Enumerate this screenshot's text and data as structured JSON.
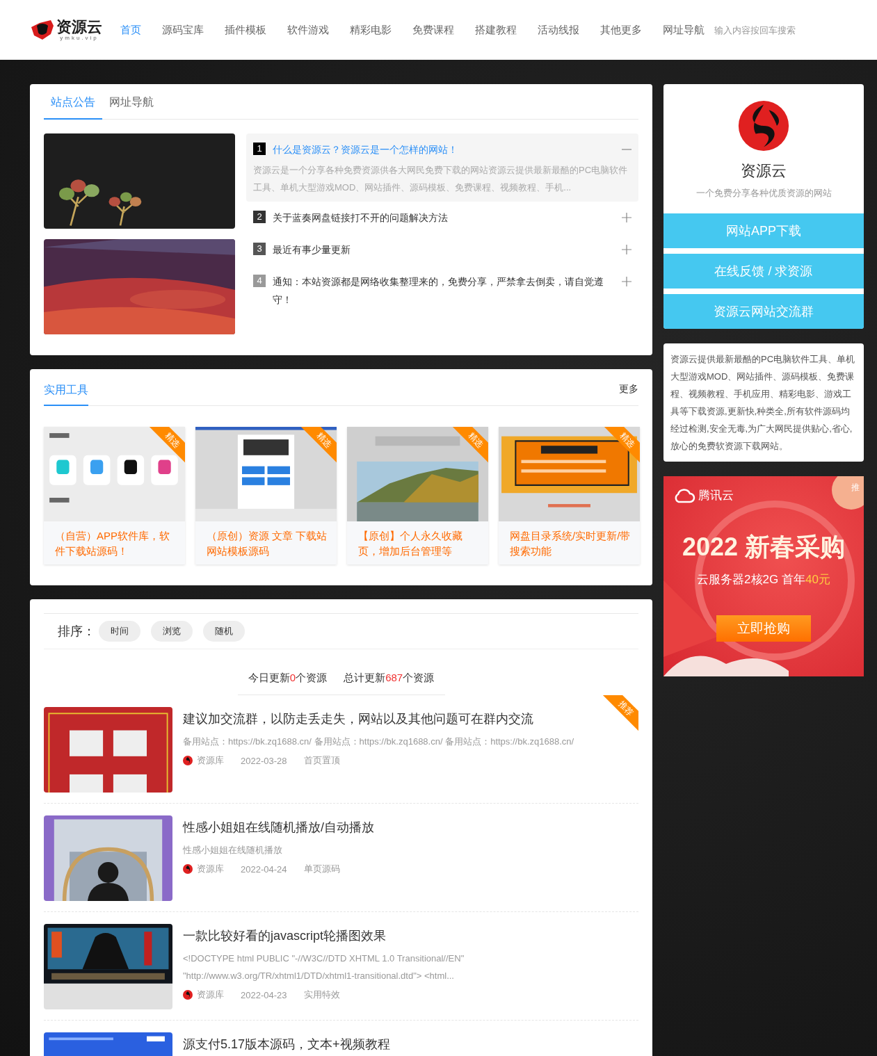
{
  "header": {
    "logo": {
      "name": "资源云",
      "domain": "ymku.vip"
    },
    "nav": [
      {
        "label": "首页",
        "selected": true
      },
      {
        "label": "源码宝库",
        "selected": false
      },
      {
        "label": "插件模板",
        "selected": false
      },
      {
        "label": "软件游戏",
        "selected": false
      },
      {
        "label": "精彩电影",
        "selected": false
      },
      {
        "label": "免费课程",
        "selected": false
      },
      {
        "label": "搭建教程",
        "selected": false
      },
      {
        "label": "活动线报",
        "selected": false
      },
      {
        "label": "其他更多",
        "selected": false
      },
      {
        "label": "网址导航",
        "selected": false
      }
    ],
    "search": {
      "placeholder": "输入内容按回车搜索"
    }
  },
  "notice_panel": {
    "tabs": [
      {
        "label": "站点公告",
        "selected": true
      },
      {
        "label": "网址导航",
        "selected": false
      }
    ],
    "notices": [
      {
        "number": "1",
        "title": "什么是资源云？资源云是一个怎样的网站！",
        "expanded": true,
        "summary": "资源云是一个分享各种免费资源供各大网民免费下载的网站资源云提供最新最酷的PC电脑软件工具、单机大型游戏MOD、网站插件、源码模板、免费课程、视频教程、手机..."
      },
      {
        "number": "2",
        "title": "关于蓝奏网盘链接打不开的问题解决方法",
        "expanded": false
      },
      {
        "number": "3",
        "title": "最近有事少量更新",
        "expanded": false
      },
      {
        "number": "4",
        "title": "通知：本站资源都是网络收集整理来的，免费分享，严禁拿去倒卖，请自觉遵守！",
        "expanded": false
      }
    ]
  },
  "tools_panel": {
    "title": "实用工具",
    "more": "更多",
    "items": [
      {
        "title": "（自营）APP软件库，软件下载站源码！",
        "badge": "精选"
      },
      {
        "title": "（原创）资源 文章 下载站网站模板源码",
        "badge": "精选"
      },
      {
        "title": "【原创】个人永久收藏页，增加后台管理等",
        "badge": "精选"
      },
      {
        "title": "网盘目录系统/实时更新/带搜索功能",
        "badge": "精选"
      }
    ]
  },
  "posts_panel": {
    "sort_label": "排序：",
    "sort_options": [
      "时间",
      "浏览",
      "随机"
    ],
    "stats": [
      {
        "prefix": "今日更新",
        "count": "0",
        "suffix": "个资源"
      },
      {
        "prefix": "总计更新",
        "count": "687",
        "suffix": "个资源"
      }
    ],
    "posts": [
      {
        "title": "建议加交流群，以防走丢走失，网站以及其他问题可在群内交流",
        "excerpt": "备用站点：https://bk.zq1688.cn/ 备用站点：https://bk.zq1688.cn/ 备用站点：https://bk.zq1688.cn/",
        "author": "资源库",
        "date": "2022-03-28",
        "category": "首页置顶",
        "badge": "推荐"
      },
      {
        "title": "性感小姐姐在线随机播放/自动播放",
        "excerpt": "性感小姐姐在线随机播放",
        "author": "资源库",
        "date": "2022-04-24",
        "category": "单页源码"
      },
      {
        "title": "一款比较好看的javascript轮播图效果",
        "excerpt": "<!DOCTYPE html PUBLIC \"-//W3C//DTD XHTML 1.0 Transitional//EN\" \"http://www.w3.org/TR/xhtml1/DTD/xhtml1-transitional.dtd\"> <html...",
        "author": "资源库",
        "date": "2022-04-23",
        "category": "实用特效"
      },
      {
        "title": "源支付5.17版本源码，文本+视频教程"
      }
    ]
  },
  "sidebar": {
    "profile": {
      "name": "资源云",
      "tagline": "一个免费分享各种优质资源的网站",
      "buttons": [
        "网站APP下载",
        "在线反馈 / 求资源",
        "资源云网站交流群"
      ]
    },
    "about": "资源云提供最新最酷的PC电脑软件工具、单机大型游戏MOD、网站插件、源码模板、免费课程、视频教程、手机应用、精彩电影、游戏工具等下载资源,更新快,种类全,所有软件源码均经过检测,安全无毒,为广大网民提供贴心,省心,放心的免费软资源下载网站。",
    "ad": {
      "brand": "腾讯云",
      "tag": "推",
      "headline": "2022 新春采购",
      "offer": "云服务器2核2G  首年",
      "price": "40元",
      "cta": "立即抢购"
    }
  }
}
